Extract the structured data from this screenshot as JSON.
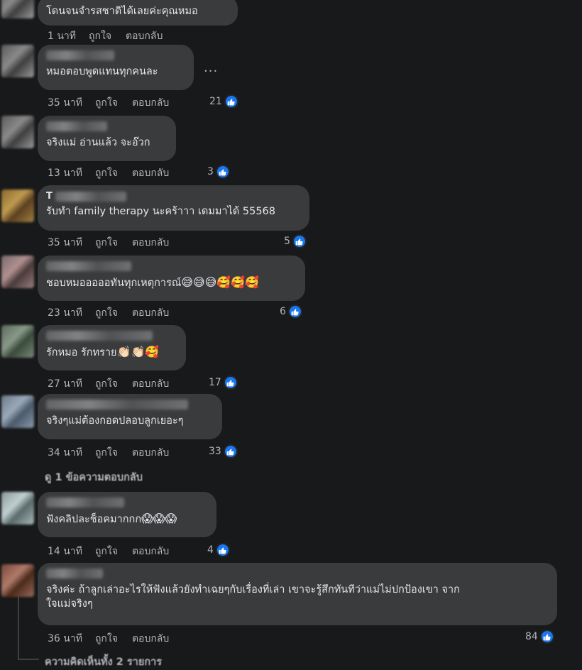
{
  "comments": [
    {
      "text": "โดนจนจำรสชาติได้เลยค่ะคุณหมอ",
      "time": "1 นาที",
      "like": "ถูกใจ",
      "reply": "ตอบกลับ",
      "likes": ""
    },
    {
      "text": "หมอตอบพูดแทนทุกคนละ",
      "time": "35 นาที",
      "like": "ถูกใจ",
      "reply": "ตอบกลับ",
      "likes": "21",
      "more": "..."
    },
    {
      "text": "จริงแม่ อ่านแล้ว จะอ๊วก",
      "time": "13 นาที",
      "like": "ถูกใจ",
      "reply": "ตอบกลับ",
      "likes": "3"
    },
    {
      "name_prefix": "T",
      "text": "รับทำ family therapy นะคร้าาา เดมมาได้ 55568",
      "time": "35 นาที",
      "like": "ถูกใจ",
      "reply": "ตอบกลับ",
      "likes": "5"
    },
    {
      "text": "ชอบหมอออออทันทุกเหตุการณ์",
      "emojis": "😅😅😅🥰🥰🥰",
      "time": "23 นาที",
      "like": "ถูกใจ",
      "reply": "ตอบกลับ",
      "likes": "6"
    },
    {
      "text": "รักหมอ รักทราย",
      "emojis": "👏🏻👏🏻🥰",
      "time": "27 นาที",
      "like": "ถูกใจ",
      "reply": "ตอบกลับ",
      "likes": "17"
    },
    {
      "text": "จริงๆแม่ต้องกอดปลอบลูกเยอะๆ",
      "time": "34 นาที",
      "like": "ถูกใจ",
      "reply": "ตอบกลับ",
      "likes": "33"
    },
    {
      "text": "ฟังคลิปละช็อคมากกก",
      "emojis": "😱😱😱",
      "time": "14 นาที",
      "like": "ถูกใจ",
      "reply": "ตอบกลับ",
      "likes": "4"
    },
    {
      "text": "จริงค่ะ ถ้าลูกเล่าอะไรให้ฟังแล้วยังทำเฉยๆกับเรื่องที่เล่า เขาจะรู้สึกทันทีว่าแม่ไม่ปกป้องเขา จาก\nใจแม่จริงๆ",
      "time": "36 นาที",
      "like": "ถูกใจ",
      "reply": "ตอบกลับ",
      "likes": "84"
    }
  ],
  "view_replies_1": "ดู 1 ข้อความตอบกลับ",
  "view_replies_2": "ความคิดเห็นทั้ง 2 รายการ",
  "colors": {
    "background": "#18191a",
    "bubble": "#3a3b3c",
    "like_blue": "#1877f2",
    "meta": "#b0b3b8"
  }
}
